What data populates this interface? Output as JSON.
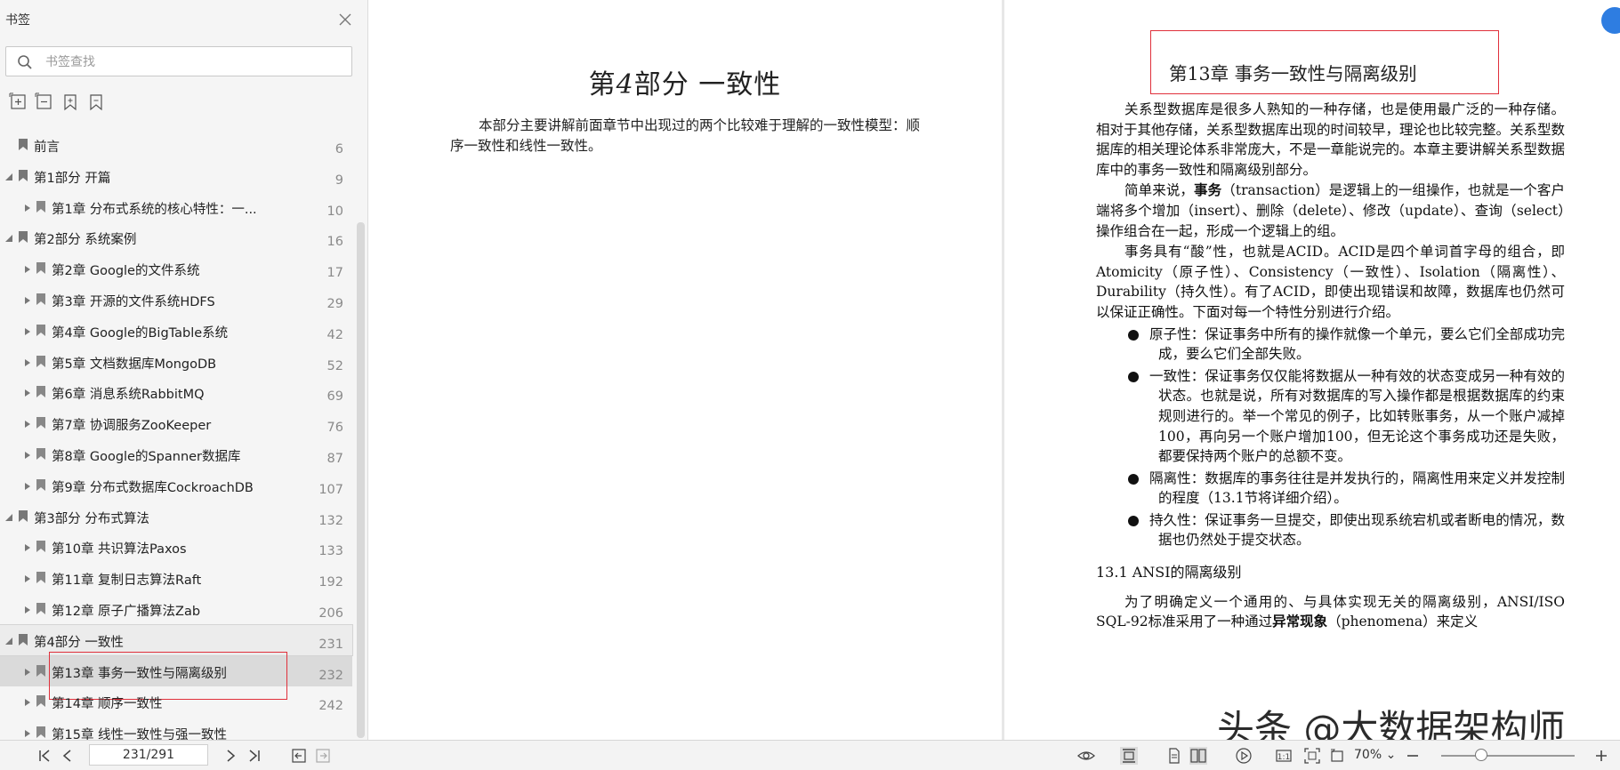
{
  "sidebar": {
    "title": "书签",
    "search_placeholder": "书签查找",
    "items": [
      {
        "label": "前言",
        "page": "6",
        "level": 0,
        "expandable": false
      },
      {
        "label": "第1部分 开篇",
        "page": "9",
        "level": 0,
        "expandable": true,
        "expanded": true
      },
      {
        "label": "第1章 分布式系统的核心特性：一...",
        "page": "10",
        "level": 1,
        "expandable": true
      },
      {
        "label": "第2部分 系统案例",
        "page": "16",
        "level": 0,
        "expandable": true,
        "expanded": true
      },
      {
        "label": "第2章 Google的文件系统",
        "page": "17",
        "level": 1,
        "expandable": true
      },
      {
        "label": "第3章 开源的文件系统HDFS",
        "page": "29",
        "level": 1,
        "expandable": true
      },
      {
        "label": "第4章 Google的BigTable系统",
        "page": "42",
        "level": 1,
        "expandable": true
      },
      {
        "label": "第5章 文档数据库MongoDB",
        "page": "52",
        "level": 1,
        "expandable": true
      },
      {
        "label": "第6章 消息系统RabbitMQ",
        "page": "69",
        "level": 1,
        "expandable": true
      },
      {
        "label": "第7章 协调服务ZooKeeper",
        "page": "76",
        "level": 1,
        "expandable": true
      },
      {
        "label": "第8章 Google的Spanner数据库",
        "page": "87",
        "level": 1,
        "expandable": true
      },
      {
        "label": "第9章 分布式数据库CockroachDB",
        "page": "107",
        "level": 1,
        "expandable": true
      },
      {
        "label": "第3部分 分布式算法",
        "page": "132",
        "level": 0,
        "expandable": true,
        "expanded": true
      },
      {
        "label": "第10章 共识算法Paxos",
        "page": "133",
        "level": 1,
        "expandable": true
      },
      {
        "label": "第11章 复制日志算法Raft",
        "page": "192",
        "level": 1,
        "expandable": true
      },
      {
        "label": "第12章 原子广播算法Zab",
        "page": "206",
        "level": 1,
        "expandable": true
      },
      {
        "label": "第4部分 一致性",
        "page": "231",
        "level": 0,
        "expandable": true,
        "expanded": true,
        "active_parent": true
      },
      {
        "label": "第13章 事务一致性与隔离级别",
        "page": "232",
        "level": 1,
        "expandable": true,
        "selected": true
      },
      {
        "label": "第14章 顺序一致性",
        "page": "242",
        "level": 1,
        "expandable": true
      },
      {
        "label": "第15章 线性一致性与强一致性",
        "page": "",
        "level": 1,
        "expandable": true
      }
    ]
  },
  "left_page": {
    "title_prefix": "第",
    "title_num": "4",
    "title_rest": "部分  一致性",
    "intro": "本部分主要讲解前面章节中出现过的两个比较难于理解的一致性模型：顺序一致性和线性一致性。"
  },
  "right_page": {
    "chapter_title": "第13章  事务一致性与隔离级别",
    "para1": "关系型数据库是很多人熟知的一种存储，也是使用最广泛的一种存储。相对于其他存储，关系型数据库出现的时间较早，理论也比较完整。关系型数据库的相关理论体系非常庞大，不是一章能说完的。本章主要讲解关系型数据库中的事务一致性和隔离级别部分。",
    "para2_pre": "简单来说，",
    "para2_bold": "事务",
    "para2_post": "（transaction）是逻辑上的一组操作，也就是一个客户端将多个增加（insert）、删除（delete）、修改（update）、查询（select）操作组合在一起，形成一个逻辑上的组。",
    "para3": "事务具有“酸”性，也就是ACID。ACID是四个单词首字母的组合，即Atomicity（原子性）、Consistency（一致性）、Isolation（隔离性）、Durability（持久性）。有了ACID，即使出现错误和故障，数据库也仍然可以保证正确性。下面对每一个特性分别进行介绍。",
    "bullets": [
      "原子性：保证事务中所有的操作就像一个单元，要么它们全部成功完成，要么它们全部失败。",
      "一致性：保证事务仅仅能将数据从一种有效的状态变成另一种有效的状态。也就是说，所有对数据库的写入操作都是根据数据库的约束规则进行的。举一个常见的例子，比如转账事务，从一个账户减掉100，再向另一个账户增加100，但无论这个事务成功还是失败，都要保持两个账户的总额不变。",
      "隔离性：数据库的事务往往是并发执行的，隔离性用来定义并发控制的程度（13.1节将详细介绍）。",
      "持久性：保证事务一旦提交，即使出现系统宕机或者断电的情况，数据也仍然处于提交状态。"
    ],
    "section_heading": "13.1  ANSI的隔离级别",
    "para4_pre": "为了明确定义一个通用的、与具体实现无关的隔离级别，ANSI/ISO SQL-92标准采用了一种通过",
    "para4_bold": "异常现象",
    "para4_post": "（phenomena）来定义"
  },
  "watermark": "头条 @大数据架构师",
  "statusbar": {
    "page_indicator": "231/291",
    "zoom": "70%",
    "zoom_fraction": 0.3
  },
  "colors": {
    "highlight_border": "#e0303b",
    "selected_row": "#dadada",
    "accent_badge": "#2e7de1"
  }
}
